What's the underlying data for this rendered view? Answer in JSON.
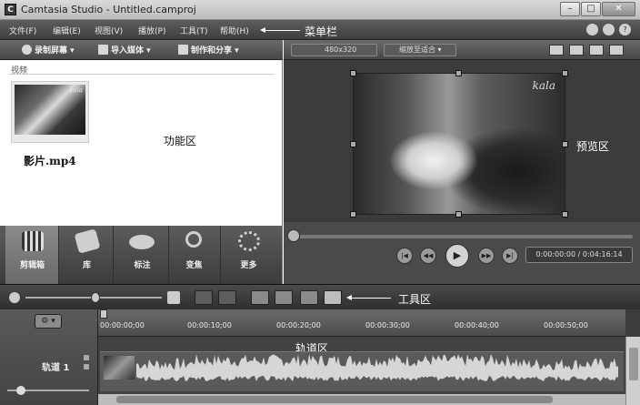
{
  "window": {
    "title": "Camtasia Studio - Untitled.camproj",
    "app_icon_letter": "C",
    "minimize_glyph": "–",
    "maximize_glyph": "□",
    "close_glyph": "✕"
  },
  "menu": {
    "items": [
      "文件(F)",
      "编辑(E)",
      "视图(V)",
      "播放(P)",
      "工具(T)",
      "帮助(H)"
    ],
    "callout": "菜单栏",
    "icons": [
      "bell-icon",
      "lightbulb-icon",
      "help-icon"
    ],
    "help_glyph": "?"
  },
  "left_toolbar": {
    "record": "录制屏幕 ▾",
    "import": "导入媒体 ▾",
    "produce": "制作和分享 ▾"
  },
  "clip_bin": {
    "header": "视频",
    "clip_name": "影片.mp4",
    "callout": "功能区",
    "thumb_watermark": "kala"
  },
  "task_tabs": [
    {
      "label": "剪辑箱",
      "icon": "film-strip-icon"
    },
    {
      "label": "库",
      "icon": "library-icon"
    },
    {
      "label": "标注",
      "icon": "speech-bubble-icon"
    },
    {
      "label": "变焦",
      "icon": "magnifier-icon"
    },
    {
      "label": "更多",
      "icon": "more-dots-icon"
    }
  ],
  "preview": {
    "dimensions": "480x320",
    "zoom_mode": "缩放至适合 ▾",
    "watermark": "kala",
    "callout": "预览区",
    "time": "0:00:00:00 / 0:04:16:14",
    "controls": {
      "start": "|◀",
      "rewind": "◀◀",
      "play": "▶",
      "forward": "▶▶",
      "end": "▶|"
    }
  },
  "timeline": {
    "callout_tools": "工具区",
    "callout_tracks": "轨道区",
    "gear_label": "⚙ ▾",
    "track_name": "轨道 1",
    "ticks": [
      "00:00:00;00",
      "00:00:10;00",
      "00:00:20;00",
      "00:00:30;00",
      "00:00:40;00",
      "00:00:50;00"
    ]
  },
  "colors": {
    "chrome_dark": "#3e3e3e",
    "chrome_mid": "#5e5e5e",
    "panel": "#4a4a4a",
    "waveform": "#d6d6d6"
  }
}
